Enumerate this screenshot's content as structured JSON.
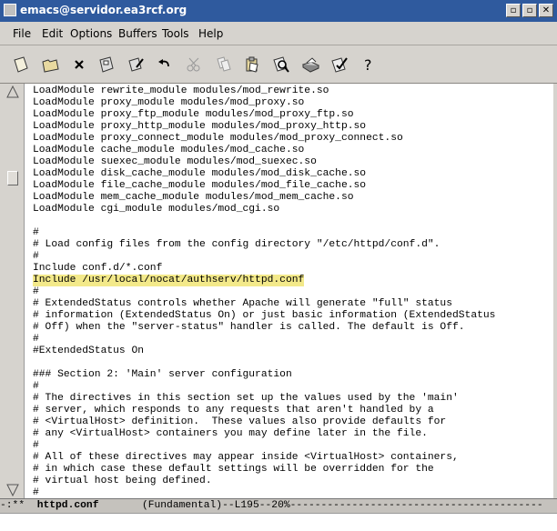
{
  "window": {
    "title": "emacs@servidor.ea3rcf.org"
  },
  "window_buttons": [
    "▫",
    "▫",
    "✕"
  ],
  "menu": [
    "File",
    "Edit",
    "Options",
    "Buffers",
    "Tools",
    "Help"
  ],
  "toolbar_icons": [
    "new-file-icon",
    "open-folder-icon",
    "close-icon",
    "save-icon",
    "save-as-icon",
    "undo-icon",
    "cut-icon",
    "copy-icon",
    "paste-icon",
    "search-icon",
    "print-icon",
    "preferences-icon",
    "help-icon"
  ],
  "lines": [
    "LoadModule rewrite_module modules/mod_rewrite.so",
    "LoadModule proxy_module modules/mod_proxy.so",
    "LoadModule proxy_ftp_module modules/mod_proxy_ftp.so",
    "LoadModule proxy_http_module modules/mod_proxy_http.so",
    "LoadModule proxy_connect_module modules/mod_proxy_connect.so",
    "LoadModule cache_module modules/mod_cache.so",
    "LoadModule suexec_module modules/mod_suexec.so",
    "LoadModule disk_cache_module modules/mod_disk_cache.so",
    "LoadModule file_cache_module modules/mod_file_cache.so",
    "LoadModule mem_cache_module modules/mod_mem_cache.so",
    "LoadModule cgi_module modules/mod_cgi.so",
    "",
    "#",
    "# Load config files from the config directory \"/etc/httpd/conf.d\".",
    "#",
    "Include conf.d/*.conf",
    "Include /usr/local/nocat/authserv/httpd.conf",
    "#",
    "# ExtendedStatus controls whether Apache will generate \"full\" status",
    "# information (ExtendedStatus On) or just basic information (ExtendedStatus",
    "# Off) when the \"server-status\" handler is called. The default is Off.",
    "#",
    "#ExtendedStatus On",
    "",
    "### Section 2: 'Main' server configuration",
    "#",
    "# The directives in this section set up the values used by the 'main'",
    "# server, which responds to any requests that aren't handled by a",
    "# <VirtualHost> definition.  These values also provide defaults for",
    "# any <VirtualHost> containers you may define later in the file.",
    "#",
    "# All of these directives may appear inside <VirtualHost> containers,",
    "# in which case these default settings will be overridden for the",
    "# virtual host being defined.",
    "#"
  ],
  "highlighted_line": 16,
  "modeline": {
    "prefix": "-:**  ",
    "buffer": "httpd.conf",
    "mode": "       (Fundamental)--L195--20%",
    "fill": "-----------------------------------------"
  },
  "colors": {
    "title_bar": "#2f5a9e",
    "highlight": "#f3e98a",
    "chrome": "#d6d3ce"
  }
}
